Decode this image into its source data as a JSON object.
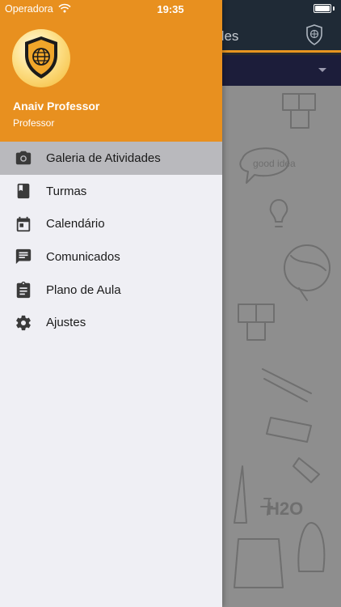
{
  "status_bar": {
    "carrier": "Operadora",
    "time": "19:35",
    "battery_level": 1.0
  },
  "app": {
    "title_fragment": "des"
  },
  "drawer": {
    "user_name": "Anaiv Professor",
    "user_role": "Professor",
    "items": [
      {
        "label": "Galeria de Atividades",
        "icon": "camera-icon",
        "active": true
      },
      {
        "label": "Turmas",
        "icon": "book-icon",
        "active": false
      },
      {
        "label": "Calendário",
        "icon": "calendar-icon",
        "active": false
      },
      {
        "label": "Comunicados",
        "icon": "message-icon",
        "active": false
      },
      {
        "label": "Plano de Aula",
        "icon": "clipboard-icon",
        "active": false
      },
      {
        "label": "Ajustes",
        "icon": "gear-icon",
        "active": false
      }
    ]
  },
  "colors": {
    "accent": "#e8901f",
    "header_dark": "#1f2a36",
    "drawer_bg": "#efeff4",
    "active_item": "#b9b9bd"
  }
}
